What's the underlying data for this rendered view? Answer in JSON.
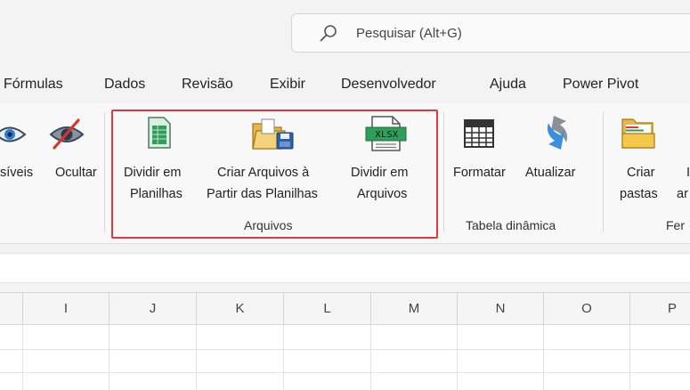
{
  "search": {
    "placeholder": "Pesquisar (Alt+G)"
  },
  "menu": [
    "Fórmulas",
    "Dados",
    "Revisão",
    "Exibir",
    "Desenvolvedor",
    "Ajuda",
    "Power Pivot"
  ],
  "ribbon": {
    "visible_partial": "síveis",
    "hide": "Ocultar",
    "split_sheets": [
      "Dividir em",
      "Planilhas"
    ],
    "create_files": [
      "Criar Arquivos à",
      "Partir das Planilhas"
    ],
    "split_files": [
      "Dividir em",
      "Arquivos"
    ],
    "group_files": "Arquivos",
    "format": "Formatar",
    "refresh": "Atualizar",
    "group_pivot": "Tabela dinâmica",
    "create_folders": [
      "Criar",
      "pastas"
    ],
    "partial_next": "ar",
    "group_tools_partial": "Fer"
  },
  "xlsx_badge": "XLSX",
  "columns": [
    "I",
    "J",
    "K",
    "L",
    "M",
    "N",
    "O",
    "P"
  ]
}
